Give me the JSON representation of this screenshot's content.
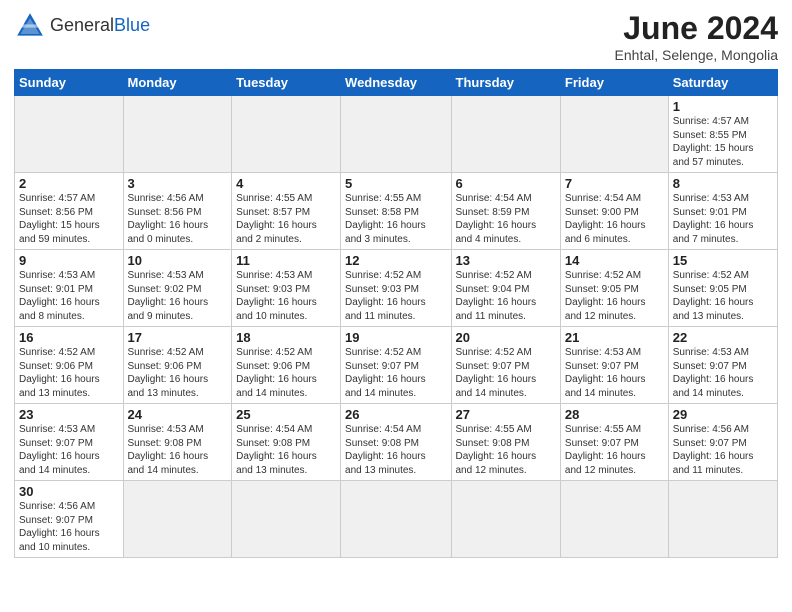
{
  "header": {
    "logo_general": "General",
    "logo_blue": "Blue",
    "title": "June 2024",
    "subtitle": "Enhtal, Selenge, Mongolia"
  },
  "days_of_week": [
    "Sunday",
    "Monday",
    "Tuesday",
    "Wednesday",
    "Thursday",
    "Friday",
    "Saturday"
  ],
  "weeks": [
    [
      {
        "day": "",
        "info": "",
        "empty": true
      },
      {
        "day": "",
        "info": "",
        "empty": true
      },
      {
        "day": "",
        "info": "",
        "empty": true
      },
      {
        "day": "",
        "info": "",
        "empty": true
      },
      {
        "day": "",
        "info": "",
        "empty": true
      },
      {
        "day": "",
        "info": "",
        "empty": true
      },
      {
        "day": "1",
        "info": "Sunrise: 4:57 AM\nSunset: 8:55 PM\nDaylight: 15 hours\nand 57 minutes."
      }
    ],
    [
      {
        "day": "2",
        "info": "Sunrise: 4:57 AM\nSunset: 8:56 PM\nDaylight: 15 hours\nand 59 minutes."
      },
      {
        "day": "3",
        "info": "Sunrise: 4:56 AM\nSunset: 8:56 PM\nDaylight: 16 hours\nand 0 minutes."
      },
      {
        "day": "4",
        "info": "Sunrise: 4:55 AM\nSunset: 8:57 PM\nDaylight: 16 hours\nand 2 minutes."
      },
      {
        "day": "5",
        "info": "Sunrise: 4:55 AM\nSunset: 8:58 PM\nDaylight: 16 hours\nand 3 minutes."
      },
      {
        "day": "6",
        "info": "Sunrise: 4:54 AM\nSunset: 8:59 PM\nDaylight: 16 hours\nand 4 minutes."
      },
      {
        "day": "7",
        "info": "Sunrise: 4:54 AM\nSunset: 9:00 PM\nDaylight: 16 hours\nand 6 minutes."
      },
      {
        "day": "8",
        "info": "Sunrise: 4:53 AM\nSunset: 9:01 PM\nDaylight: 16 hours\nand 7 minutes."
      }
    ],
    [
      {
        "day": "9",
        "info": "Sunrise: 4:53 AM\nSunset: 9:01 PM\nDaylight: 16 hours\nand 8 minutes."
      },
      {
        "day": "10",
        "info": "Sunrise: 4:53 AM\nSunset: 9:02 PM\nDaylight: 16 hours\nand 9 minutes."
      },
      {
        "day": "11",
        "info": "Sunrise: 4:53 AM\nSunset: 9:03 PM\nDaylight: 16 hours\nand 10 minutes."
      },
      {
        "day": "12",
        "info": "Sunrise: 4:52 AM\nSunset: 9:03 PM\nDaylight: 16 hours\nand 11 minutes."
      },
      {
        "day": "13",
        "info": "Sunrise: 4:52 AM\nSunset: 9:04 PM\nDaylight: 16 hours\nand 11 minutes."
      },
      {
        "day": "14",
        "info": "Sunrise: 4:52 AM\nSunset: 9:05 PM\nDaylight: 16 hours\nand 12 minutes."
      },
      {
        "day": "15",
        "info": "Sunrise: 4:52 AM\nSunset: 9:05 PM\nDaylight: 16 hours\nand 13 minutes."
      }
    ],
    [
      {
        "day": "16",
        "info": "Sunrise: 4:52 AM\nSunset: 9:06 PM\nDaylight: 16 hours\nand 13 minutes."
      },
      {
        "day": "17",
        "info": "Sunrise: 4:52 AM\nSunset: 9:06 PM\nDaylight: 16 hours\nand 13 minutes."
      },
      {
        "day": "18",
        "info": "Sunrise: 4:52 AM\nSunset: 9:06 PM\nDaylight: 16 hours\nand 14 minutes."
      },
      {
        "day": "19",
        "info": "Sunrise: 4:52 AM\nSunset: 9:07 PM\nDaylight: 16 hours\nand 14 minutes."
      },
      {
        "day": "20",
        "info": "Sunrise: 4:52 AM\nSunset: 9:07 PM\nDaylight: 16 hours\nand 14 minutes."
      },
      {
        "day": "21",
        "info": "Sunrise: 4:53 AM\nSunset: 9:07 PM\nDaylight: 16 hours\nand 14 minutes."
      },
      {
        "day": "22",
        "info": "Sunrise: 4:53 AM\nSunset: 9:07 PM\nDaylight: 16 hours\nand 14 minutes."
      }
    ],
    [
      {
        "day": "23",
        "info": "Sunrise: 4:53 AM\nSunset: 9:07 PM\nDaylight: 16 hours\nand 14 minutes."
      },
      {
        "day": "24",
        "info": "Sunrise: 4:53 AM\nSunset: 9:08 PM\nDaylight: 16 hours\nand 14 minutes."
      },
      {
        "day": "25",
        "info": "Sunrise: 4:54 AM\nSunset: 9:08 PM\nDaylight: 16 hours\nand 13 minutes."
      },
      {
        "day": "26",
        "info": "Sunrise: 4:54 AM\nSunset: 9:08 PM\nDaylight: 16 hours\nand 13 minutes."
      },
      {
        "day": "27",
        "info": "Sunrise: 4:55 AM\nSunset: 9:08 PM\nDaylight: 16 hours\nand 12 minutes."
      },
      {
        "day": "28",
        "info": "Sunrise: 4:55 AM\nSunset: 9:07 PM\nDaylight: 16 hours\nand 12 minutes."
      },
      {
        "day": "29",
        "info": "Sunrise: 4:56 AM\nSunset: 9:07 PM\nDaylight: 16 hours\nand 11 minutes."
      }
    ],
    [
      {
        "day": "30",
        "info": "Sunrise: 4:56 AM\nSunset: 9:07 PM\nDaylight: 16 hours\nand 10 minutes."
      },
      {
        "day": "",
        "info": "",
        "empty": true
      },
      {
        "day": "",
        "info": "",
        "empty": true
      },
      {
        "day": "",
        "info": "",
        "empty": true
      },
      {
        "day": "",
        "info": "",
        "empty": true
      },
      {
        "day": "",
        "info": "",
        "empty": true
      },
      {
        "day": "",
        "info": "",
        "empty": true
      }
    ]
  ]
}
